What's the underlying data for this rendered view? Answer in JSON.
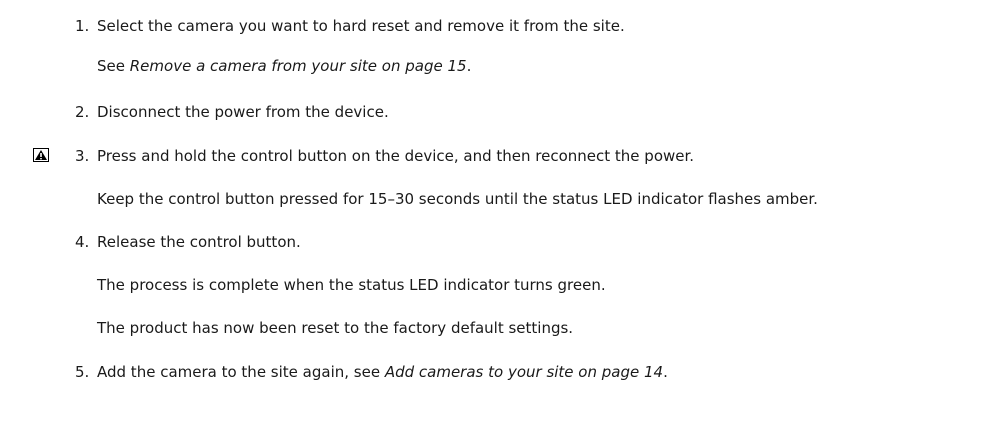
{
  "steps": [
    {
      "number": "1.",
      "text": "Select the camera you want to hard reset and remove it from the site.",
      "see_prefix": "See ",
      "see_link": "Remove a camera from your site on page 15",
      "see_suffix": "."
    },
    {
      "number": "2.",
      "text": "Disconnect the power from the device."
    },
    {
      "number": "3.",
      "text": "Press and hold the control button on the device, and then reconnect the power.",
      "note": "Keep the control button pressed for 15–30 seconds until the status LED indicator flashes amber."
    },
    {
      "number": "4.",
      "text": "Release the control button.",
      "note1": "The process is complete when the status LED indicator turns green.",
      "note2": "The product has now been reset to the factory default settings."
    },
    {
      "number": "5.",
      "text_prefix": "Add the camera to the site again, see ",
      "link": "Add cameras to your site on page 14",
      "text_suffix": "."
    }
  ],
  "icons": {
    "warning": "warning-icon"
  }
}
